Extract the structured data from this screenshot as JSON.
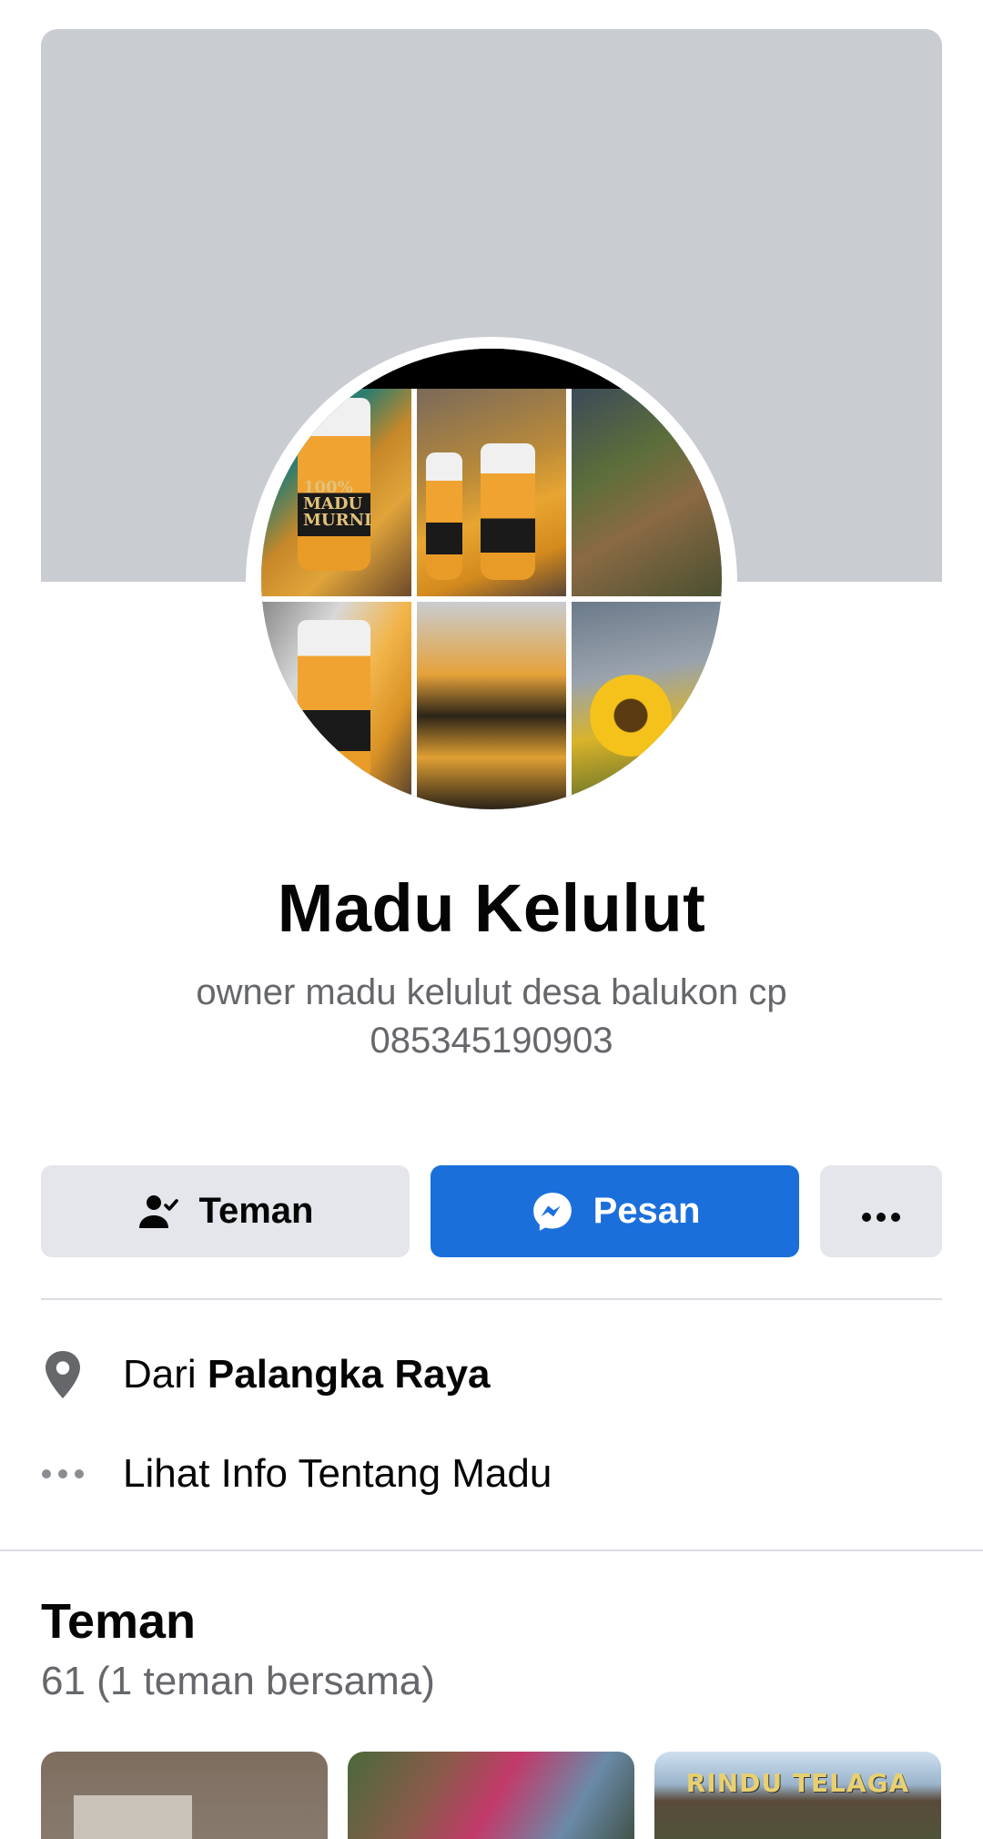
{
  "profile": {
    "name": "Madu Kelulut",
    "bio": "owner madu kelulut desa balukon cp 085345190903"
  },
  "actions": {
    "friend_label": "Teman",
    "message_label": "Pesan",
    "more_icon": "more-dots-icon",
    "friend_icon": "person-check-icon",
    "message_icon": "messenger-icon"
  },
  "details": [
    {
      "icon": "location-pin-icon",
      "prefix": "Dari ",
      "value": "Palangka Raya"
    },
    {
      "icon": "more-dots-icon",
      "text": "Lihat Info Tentang Madu"
    }
  ],
  "friends": {
    "title": "Teman",
    "summary": "61 (1 teman bersama)",
    "thumb3_sign": "RINDU TELAGA"
  },
  "avatar_photo": {
    "label_line1": "100%",
    "label_line2": "MADU",
    "label_line3": "MURNI"
  },
  "colors": {
    "primary": "#1b6fdb",
    "secondary_button": "#e4e6eb",
    "cover": "#c9ccd1",
    "muted_text": "#65676b"
  }
}
